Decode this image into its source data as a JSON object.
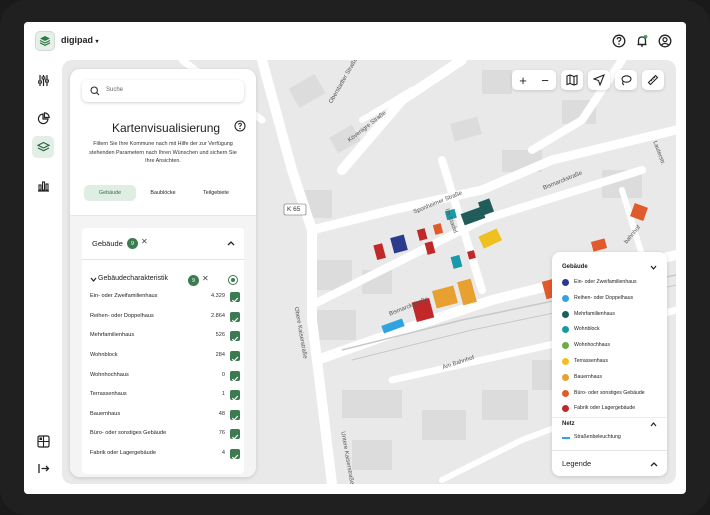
{
  "app": {
    "name": "digipad",
    "name_caret": "▾"
  },
  "search": {
    "placeholder": "Suche"
  },
  "panel": {
    "title": "Kartenvisualisierung",
    "description": "Filtern Sie Ihre Kommune nach mit Hilfe der zur Verfügung stehenden Parametern nach Ihren Wünschen und sichern Sie Ihre Ansichten.",
    "tabs": [
      {
        "label": "Gebäude",
        "active": true
      },
      {
        "label": "Baublöcke",
        "active": false
      },
      {
        "label": "Teilgebiete",
        "active": false
      }
    ]
  },
  "filter": {
    "section_title": "Gebäude",
    "section_badge": "9",
    "sub_title": "Gebäudecharakteristik",
    "sub_badge": "9",
    "rows": [
      {
        "label": "Ein- oder Zweifamilienhaus",
        "count": "4.329"
      },
      {
        "label": "Reihen- oder Doppelhaus",
        "count": "2.864"
      },
      {
        "label": "Mehrfamilienhaus",
        "count": "526"
      },
      {
        "label": "Wohnblock",
        "count": "284"
      },
      {
        "label": "Wohnhochhaus",
        "count": "0"
      },
      {
        "label": "Terrassenhaus",
        "count": "1"
      },
      {
        "label": "Bauernhaus",
        "count": "48"
      },
      {
        "label": "Büro- oder sonstiges Gebäude",
        "count": "76"
      },
      {
        "label": "Fabrik oder Lagergebäude",
        "count": "4"
      }
    ]
  },
  "legend": {
    "group1": "Gebäude",
    "items": [
      {
        "label": "Ein- oder Zweifamilienhaus",
        "color": "#2b3a8a"
      },
      {
        "label": "Reihen- oder Doppelhaus",
        "color": "#2fa4e0"
      },
      {
        "label": "Mehrfamilienhaus",
        "color": "#1f5c5a"
      },
      {
        "label": "Wohnblock",
        "color": "#1a9aa8"
      },
      {
        "label": "Wohnhochhaus",
        "color": "#6aab45"
      },
      {
        "label": "Terrassenhaus",
        "color": "#f0c020"
      },
      {
        "label": "Bauernhaus",
        "color": "#e8a030"
      },
      {
        "label": "Büro- oder sonstiges Gebäude",
        "color": "#e05a2b"
      },
      {
        "label": "Fabrik oder Lagergebäude",
        "color": "#c0282a"
      }
    ],
    "group2": "Netz",
    "net_item": {
      "label": "Straßenbeleuchtung",
      "color": "#2fa4e0"
    },
    "footer": "Legende"
  },
  "map": {
    "streets": [
      "Oberstadter Straße",
      "Kövenigre Straße",
      "Sponheimer Straße",
      "Bismarckstraße",
      "Obere Kaiserstraße",
      "Am Bahnhof",
      "Untere Kaiserstraße",
      "Lauterstr.",
      "bahnhof",
      "K 65",
      "Im Stadel"
    ]
  },
  "colors": {
    "accent": "#3c7a52",
    "accent_light": "#dfeee3"
  }
}
